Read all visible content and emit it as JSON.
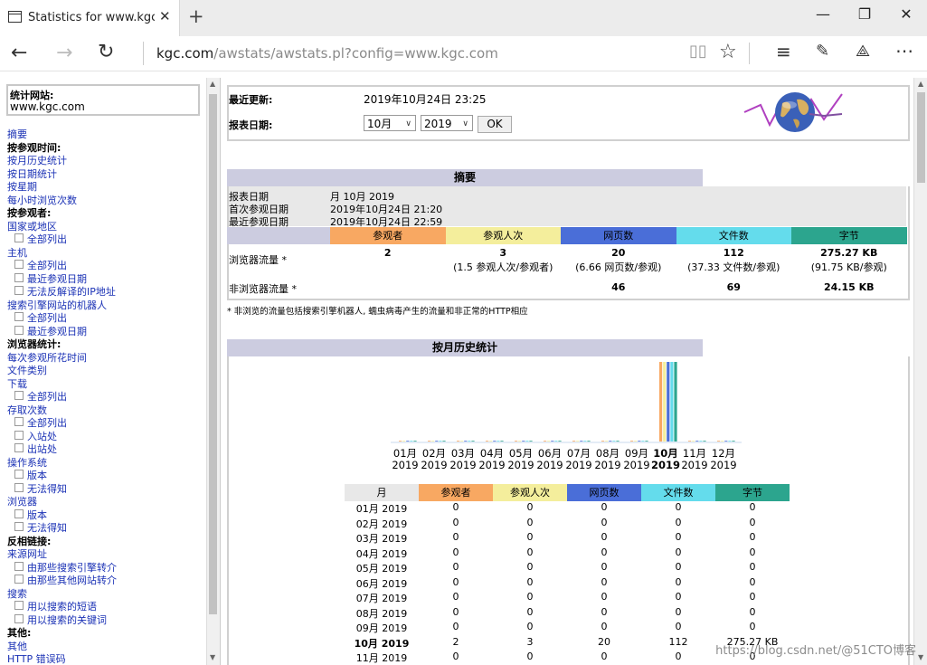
{
  "browser": {
    "tab_title": "Statistics for www.kgc.co",
    "address_host": "kgc.com",
    "address_rest": "/awstats/awstats.pl?config=www.kgc.com"
  },
  "sidebar": {
    "site_label": "统计网站:",
    "site_value": "www.kgc.com",
    "items": [
      {
        "label": "摘要",
        "type": "link"
      },
      {
        "label": "按参观时间:",
        "type": "header"
      },
      {
        "label": "按月历史统计",
        "type": "link"
      },
      {
        "label": "按日期统计",
        "type": "link"
      },
      {
        "label": "按星期",
        "type": "link"
      },
      {
        "label": "每小时浏览次数",
        "type": "link"
      },
      {
        "label": "按参观者:",
        "type": "header"
      },
      {
        "label": "国家或地区",
        "type": "link"
      },
      {
        "label": "全部列出",
        "type": "sub"
      },
      {
        "label": "主机",
        "type": "link"
      },
      {
        "label": "全部列出",
        "type": "sub"
      },
      {
        "label": "最近参观日期",
        "type": "sub"
      },
      {
        "label": "无法反解译的IP地址",
        "type": "sub"
      },
      {
        "label": "搜索引擎网站的机器人",
        "type": "link"
      },
      {
        "label": "全部列出",
        "type": "sub"
      },
      {
        "label": "最近参观日期",
        "type": "sub"
      },
      {
        "label": "浏览器统计:",
        "type": "header"
      },
      {
        "label": "每次参观所花时间",
        "type": "link"
      },
      {
        "label": "文件类别",
        "type": "link"
      },
      {
        "label": "下载",
        "type": "link"
      },
      {
        "label": "全部列出",
        "type": "sub"
      },
      {
        "label": "存取次数",
        "type": "link"
      },
      {
        "label": "全部列出",
        "type": "sub"
      },
      {
        "label": "入站处",
        "type": "sub"
      },
      {
        "label": "出站处",
        "type": "sub"
      },
      {
        "label": "操作系统",
        "type": "link"
      },
      {
        "label": "版本",
        "type": "sub"
      },
      {
        "label": "无法得知",
        "type": "sub"
      },
      {
        "label": "浏览器",
        "type": "link"
      },
      {
        "label": "版本",
        "type": "sub"
      },
      {
        "label": "无法得知",
        "type": "sub"
      },
      {
        "label": "反相链接:",
        "type": "header"
      },
      {
        "label": "来源网址",
        "type": "link"
      },
      {
        "label": "由那些搜索引擎转介",
        "type": "sub"
      },
      {
        "label": "由那些其他网站转介",
        "type": "sub"
      },
      {
        "label": "搜索",
        "type": "link"
      },
      {
        "label": "用以搜索的短语",
        "type": "sub"
      },
      {
        "label": "用以搜索的关键词",
        "type": "sub"
      },
      {
        "label": "其他:",
        "type": "header"
      },
      {
        "label": "其他",
        "type": "link"
      },
      {
        "label": "HTTP 错误码",
        "type": "link"
      }
    ]
  },
  "header": {
    "last_update_label": "最近更新:",
    "last_update_value": "2019年10月24日 23:25",
    "report_date_label": "报表日期:",
    "month_select": "10月",
    "year_select": "2019",
    "ok_label": "OK"
  },
  "summary": {
    "title": "摘要",
    "report_date_label": "报表日期",
    "report_date_value": "月 10月 2019",
    "first_visit_label": "首次参观日期",
    "first_visit_value": "2019年10月24日 21:20",
    "last_visit_label": "最近参观日期",
    "last_visit_value": "2019年10月24日 22:59",
    "columns": [
      "参观者",
      "参观人次",
      "网页数",
      "文件数",
      "字节"
    ],
    "col_colors": [
      "#f8a862",
      "#f4ee9c",
      "#4a6ed8",
      "#64dcec",
      "#2ca58e"
    ],
    "traffic_label": "浏览器流量 *",
    "traffic_values": [
      "2",
      "3",
      "20",
      "112",
      "275.27 KB"
    ],
    "traffic_sub": [
      "",
      "(1.5 参观人次/参观者)",
      "(6.66 网页数/参观)",
      "(37.33 文件数/参观)",
      "(91.75 KB/参观)"
    ],
    "nontraffic_label": "非浏览器流量 *",
    "nontraffic_values": [
      "",
      "",
      "46",
      "69",
      "24.15 KB"
    ],
    "footnote": "* 非浏览的流量包括搜索引擎机器人, 蠕虫病毒产生的流量和非正常的HTTP相应"
  },
  "monthly": {
    "title": "按月历史统计",
    "month_col": "月",
    "months": [
      "01月",
      "02月",
      "03月",
      "04月",
      "05月",
      "06月",
      "07月",
      "08月",
      "09月",
      "10月",
      "11月",
      "12月"
    ],
    "year": "2019",
    "highlight_index": 9,
    "rows": [
      {
        "month": "01月 2019",
        "v": [
          "0",
          "0",
          "0",
          "0",
          "0"
        ]
      },
      {
        "month": "02月 2019",
        "v": [
          "0",
          "0",
          "0",
          "0",
          "0"
        ]
      },
      {
        "month": "03月 2019",
        "v": [
          "0",
          "0",
          "0",
          "0",
          "0"
        ]
      },
      {
        "month": "04月 2019",
        "v": [
          "0",
          "0",
          "0",
          "0",
          "0"
        ]
      },
      {
        "month": "05月 2019",
        "v": [
          "0",
          "0",
          "0",
          "0",
          "0"
        ]
      },
      {
        "month": "06月 2019",
        "v": [
          "0",
          "0",
          "0",
          "0",
          "0"
        ]
      },
      {
        "month": "07月 2019",
        "v": [
          "0",
          "0",
          "0",
          "0",
          "0"
        ]
      },
      {
        "month": "08月 2019",
        "v": [
          "0",
          "0",
          "0",
          "0",
          "0"
        ]
      },
      {
        "month": "09月 2019",
        "v": [
          "0",
          "0",
          "0",
          "0",
          "0"
        ]
      },
      {
        "month": "10月 2019",
        "v": [
          "2",
          "3",
          "20",
          "112",
          "275.27 KB"
        ]
      },
      {
        "month": "11月 2019",
        "v": [
          "0",
          "0",
          "0",
          "0",
          "0"
        ]
      }
    ]
  },
  "chart_data": {
    "type": "bar",
    "categories": [
      "01月 2019",
      "02月 2019",
      "03月 2019",
      "04月 2019",
      "05月 2019",
      "06月 2019",
      "07月 2019",
      "08月 2019",
      "09月 2019",
      "10月 2019",
      "11月 2019",
      "12月 2019"
    ],
    "series": [
      {
        "name": "参观者",
        "color": "#f8a862",
        "values": [
          0,
          0,
          0,
          0,
          0,
          0,
          0,
          0,
          0,
          2,
          0,
          0
        ]
      },
      {
        "name": "参观人次",
        "color": "#f4ee9c",
        "values": [
          0,
          0,
          0,
          0,
          0,
          0,
          0,
          0,
          0,
          3,
          0,
          0
        ]
      },
      {
        "name": "网页数",
        "color": "#4a6ed8",
        "values": [
          0,
          0,
          0,
          0,
          0,
          0,
          0,
          0,
          0,
          20,
          0,
          0
        ]
      },
      {
        "name": "文件数",
        "color": "#64dcec",
        "values": [
          0,
          0,
          0,
          0,
          0,
          0,
          0,
          0,
          0,
          112,
          0,
          0
        ]
      },
      {
        "name": "字节",
        "color": "#2ca58e",
        "values": [
          0,
          0,
          0,
          0,
          0,
          0,
          0,
          0,
          0,
          275.27,
          0,
          0
        ]
      }
    ]
  },
  "watermark": "https://blog.csdn.net/@51CTO博客"
}
